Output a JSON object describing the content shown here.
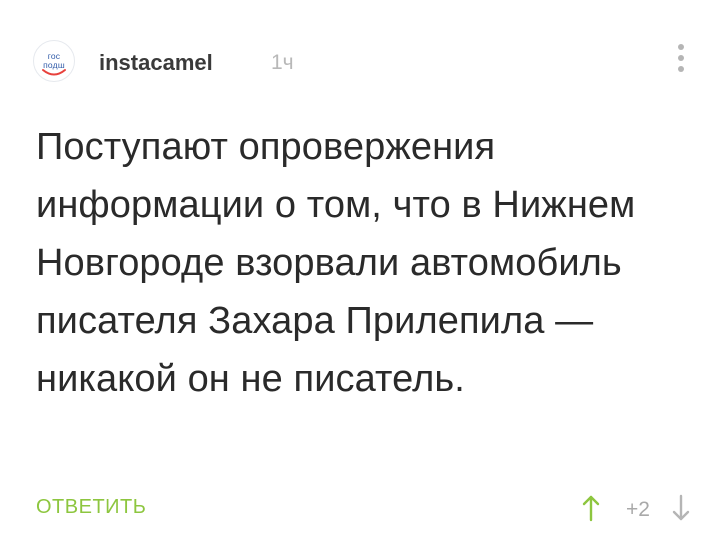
{
  "comment": {
    "avatar": {
      "logo_line1": "гос",
      "logo_line2": "подш",
      "icon": "gosuslugi-logo"
    },
    "author": "instacamel",
    "timestamp": "1ч",
    "text": "Поступают опровержения информации о том, что в Нижнем Новгороде взорвали автомобиль писателя Захара Прилепила — никакой он не писатель.",
    "reply_label": "ОТВЕТИТЬ",
    "score": "+2",
    "colors": {
      "accent_green": "#8dc63f",
      "vote_green": "#8dc63f",
      "muted_gray": "#b5b5b5",
      "logo_blue": "#2f5aa8",
      "logo_red": "#e8413c"
    }
  }
}
